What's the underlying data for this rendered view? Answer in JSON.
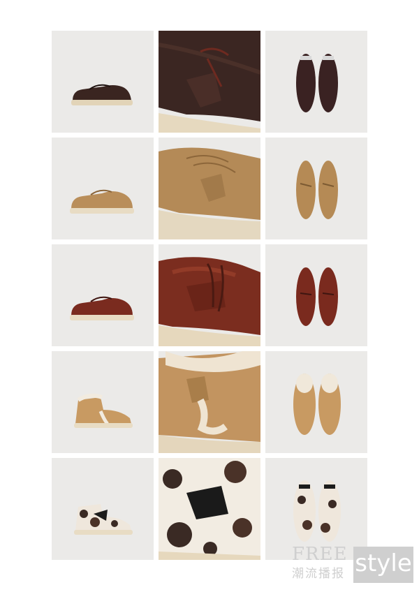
{
  "watermark": {
    "free": "FREE",
    "chinese": "潮流播报",
    "style": "style"
  },
  "tiles": [
    {
      "row": "brown-pony-hair-wallabee",
      "views": [
        "side",
        "detail",
        "top"
      ],
      "color": "#3b2520"
    },
    {
      "row": "sand-suede-wallabee",
      "views": [
        "side",
        "detail",
        "top"
      ],
      "color": "#b98f5c"
    },
    {
      "row": "burgundy-leather-wallabee",
      "views": [
        "side",
        "detail",
        "top"
      ],
      "color": "#7a2a1e"
    },
    {
      "row": "shearling-lined-desert-boot",
      "views": [
        "side",
        "detail",
        "top"
      ],
      "color": "#c89a64"
    },
    {
      "row": "cow-print-desert-boot",
      "views": [
        "side",
        "detail",
        "top"
      ],
      "color": "#e8e2d8"
    }
  ]
}
